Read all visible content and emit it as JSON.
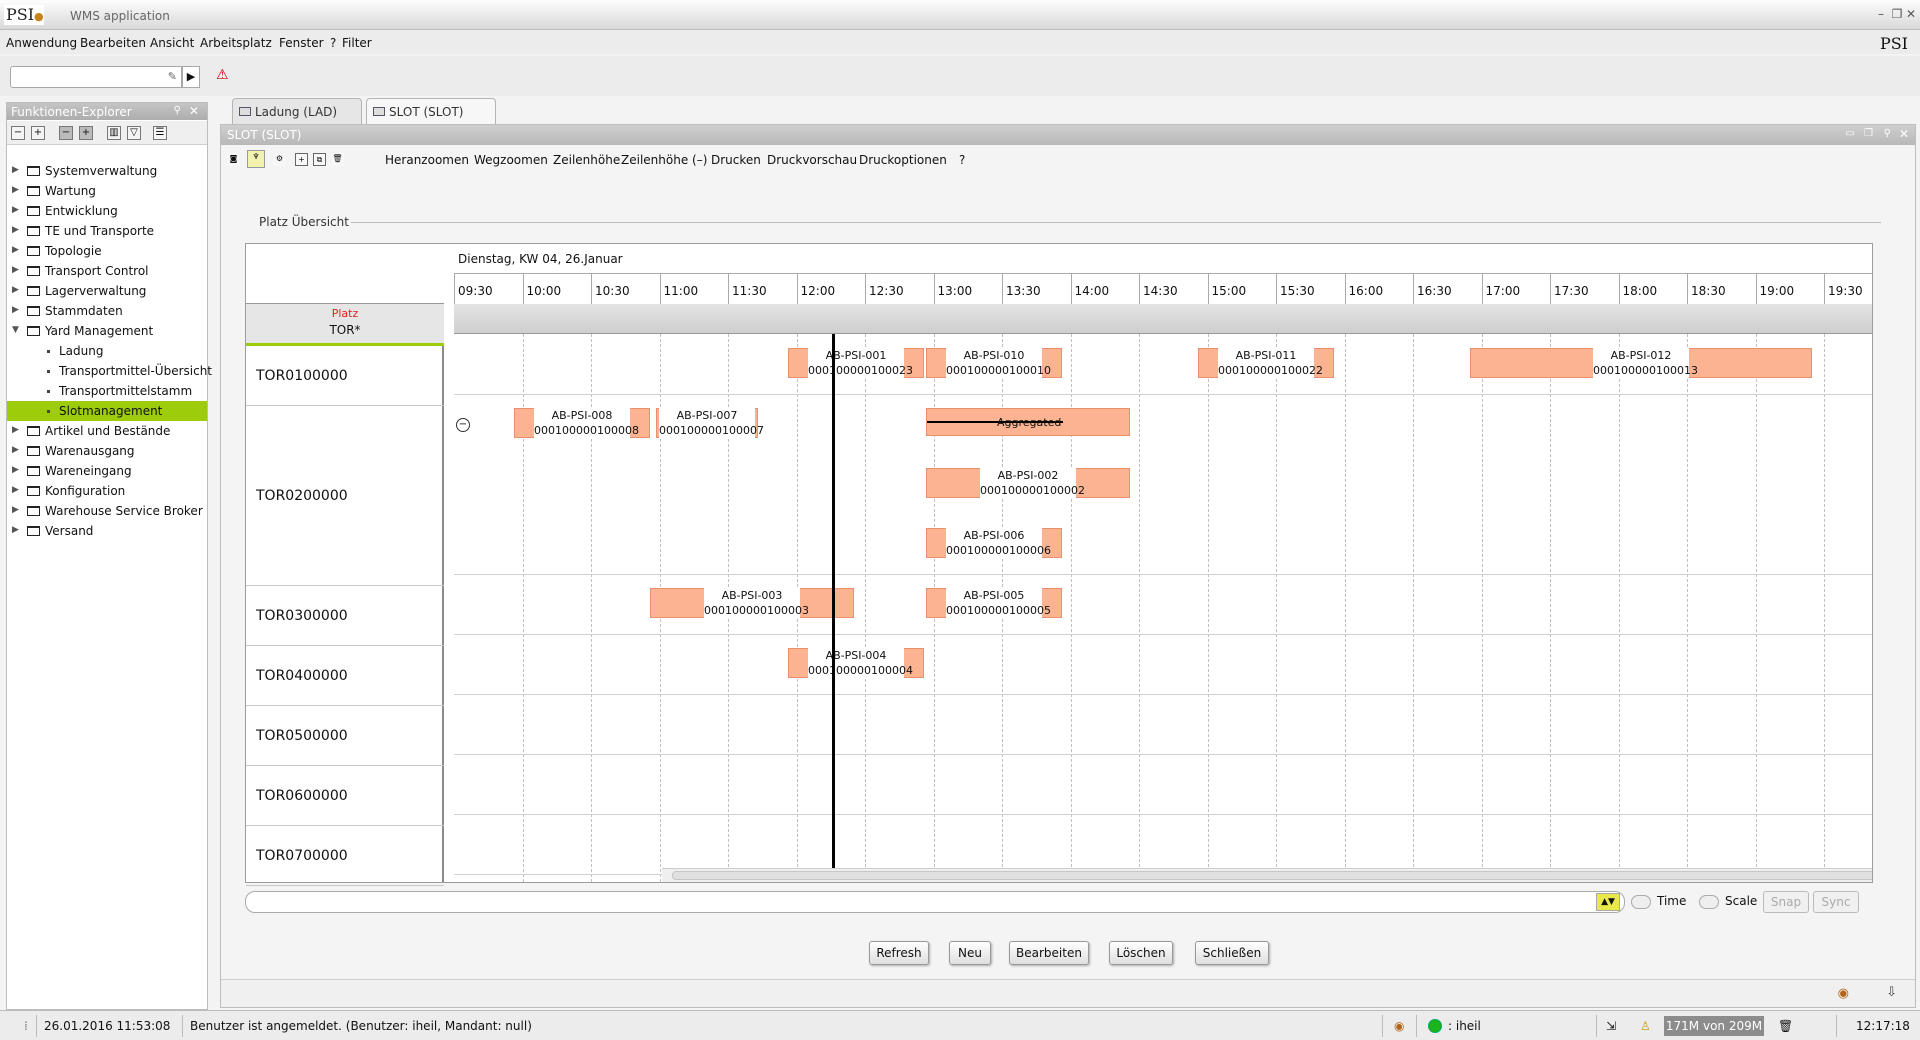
{
  "app": {
    "logo": "PSI",
    "title": "WMS application",
    "brand": "PSI"
  },
  "menu": [
    "Anwendung",
    "Bearbeiten",
    "Ansicht",
    "Arbeitsplatz",
    "Fenster",
    "?",
    "Filter"
  ],
  "explorer": {
    "title": "Funktionen-Explorer",
    "items": [
      {
        "label": "Systemverwaltung",
        "level": 0
      },
      {
        "label": "Wartung",
        "level": 0
      },
      {
        "label": "Entwicklung",
        "level": 0
      },
      {
        "label": "TE und Transporte",
        "level": 0
      },
      {
        "label": "Topologie",
        "level": 0
      },
      {
        "label": "Transport Control",
        "level": 0
      },
      {
        "label": "Lagerverwaltung",
        "level": 0
      },
      {
        "label": "Stammdaten",
        "level": 0
      },
      {
        "label": "Yard Management",
        "level": 0,
        "expanded": true
      },
      {
        "label": "Ladung",
        "level": 1
      },
      {
        "label": "Transportmittel-Übersicht",
        "level": 1
      },
      {
        "label": "Transportmittelstamm",
        "level": 1
      },
      {
        "label": "Slotmanagement",
        "level": 1,
        "selected": true
      },
      {
        "label": "Artikel und Bestände",
        "level": 0
      },
      {
        "label": "Warenausgang",
        "level": 0
      },
      {
        "label": "Wareneingang",
        "level": 0
      },
      {
        "label": "Konfiguration",
        "level": 0
      },
      {
        "label": "Warehouse Service Broker",
        "level": 0
      },
      {
        "label": "Versand",
        "level": 0
      }
    ]
  },
  "tabs": [
    {
      "label": "Ladung  (LAD)",
      "active": false
    },
    {
      "label": "SLOT  (SLOT)",
      "active": true
    }
  ],
  "panel": {
    "title": "SLOT  (SLOT)",
    "toolbar": [
      "Heranzoomen",
      "Wegzoomen",
      "Zeilenhöhe",
      "Zeilenhöhe (–)",
      "Drucken",
      "Druckvorschau",
      "Druckoptionen"
    ],
    "section_title": "Platz Übersicht"
  },
  "gantt": {
    "date_label": "Dienstag, KW 04, 26.Januar",
    "platz_label": "Platz",
    "platz_filter": "TOR*",
    "times": [
      "09:30",
      "10:00",
      "10:30",
      "11:00",
      "11:30",
      "12:00",
      "12:30",
      "13:00",
      "13:30",
      "14:00",
      "14:30",
      "15:00",
      "15:30",
      "16:00",
      "16:30",
      "17:00",
      "17:30",
      "18:00",
      "18:30",
      "19:00",
      "19:30"
    ],
    "rows": [
      "TOR0100000",
      "TOR0200000",
      "TOR0300000",
      "TOR0400000",
      "TOR0500000",
      "TOR0600000",
      "TOR0700000"
    ],
    "aggregated_label": "Aggregated",
    "slots": [
      {
        "id": "AB-PSI-001",
        "number": "000100000100023"
      },
      {
        "id": "AB-PSI-010",
        "number": "000100000100010"
      },
      {
        "id": "AB-PSI-011",
        "number": "000100000100022"
      },
      {
        "id": "AB-PSI-012",
        "number": "000100000100013"
      },
      {
        "id": "AB-PSI-008",
        "number": "000100000100008"
      },
      {
        "id": "AB-PSI-007",
        "number": "000100000100007"
      },
      {
        "id": "AB-PSI-002",
        "number": "000100000100002"
      },
      {
        "id": "AB-PSI-006",
        "number": "000100000100006"
      },
      {
        "id": "AB-PSI-003",
        "number": "000100000100003"
      },
      {
        "id": "AB-PSI-005",
        "number": "000100000100005"
      },
      {
        "id": "AB-PSI-004",
        "number": "000100000100004"
      }
    ]
  },
  "controls": {
    "time": "Time",
    "scale": "Scale",
    "snap": "Snap",
    "sync": "Sync"
  },
  "buttons": [
    "Refresh",
    "Neu",
    "Bearbeiten",
    "Löschen",
    "Schließen"
  ],
  "status": {
    "datetime": "26.01.2016 11:53:08",
    "message": "Benutzer ist angemeldet. (Benutzer: iheil, Mandant: null)",
    "user": ": iheil",
    "memory": "171M von 209M",
    "clock": "12:17:18"
  },
  "colors": {
    "selection": "#9dcd0a",
    "slot_fill": "#fbb391",
    "slot_border": "#e8906b"
  }
}
